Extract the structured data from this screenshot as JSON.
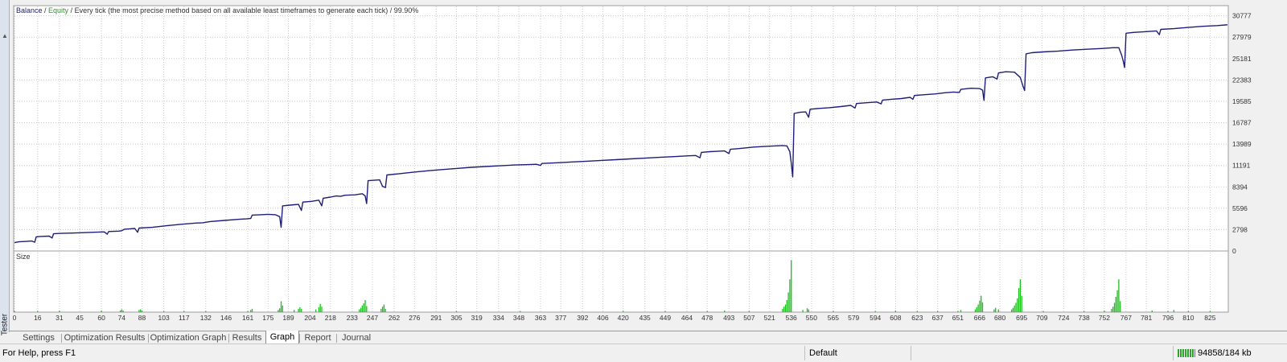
{
  "chart_header": {
    "balance": "Balance",
    "sep1": " / ",
    "equity": "Equity",
    "rest": " / Every tick (the most precise method based on all available least timeframes to generate each tick) / 99.90%"
  },
  "lower_pane_label": "Size",
  "side_caption": "Tester",
  "tabs": [
    "Settings",
    "Optimization Results",
    "Optimization Graph",
    "Results",
    "Graph",
    "Report",
    "Journal"
  ],
  "active_tab": "Graph",
  "status": {
    "help": "For Help, press F1",
    "profile": "Default",
    "memory": "94858/184 kb"
  },
  "colors": {
    "balance": "#1e1e78",
    "equity": "#2a9a2a",
    "size_bars": "#1bbf1b",
    "grid": "#c8c8c8",
    "background": "#ffffff"
  },
  "chart_data": {
    "type": "line",
    "series": [
      {
        "name": "Balance"
      },
      {
        "name": "Equity"
      }
    ],
    "x_ticks": [
      0,
      16,
      31,
      45,
      60,
      74,
      88,
      103,
      117,
      132,
      146,
      161,
      175,
      189,
      204,
      218,
      233,
      247,
      262,
      276,
      291,
      305,
      319,
      334,
      348,
      363,
      377,
      392,
      406,
      420,
      435,
      449,
      464,
      478,
      493,
      507,
      521,
      536,
      550,
      565,
      579,
      594,
      608,
      623,
      637,
      651,
      666,
      680,
      695,
      709,
      724,
      738,
      752,
      767,
      781,
      796,
      810,
      825
    ],
    "y_ticks": [
      0,
      2798,
      5596,
      8394,
      11191,
      13989,
      16787,
      19585,
      22383,
      25181,
      27979,
      30777
    ],
    "xlim": [
      0,
      837
    ],
    "ylim": [
      0,
      32000
    ],
    "balance_points": [
      [
        0,
        1100
      ],
      [
        3,
        1200
      ],
      [
        8,
        1250
      ],
      [
        12,
        1300
      ],
      [
        14,
        1150
      ],
      [
        15,
        1850
      ],
      [
        18,
        1900
      ],
      [
        24,
        1950
      ],
      [
        26,
        1700
      ],
      [
        27,
        2250
      ],
      [
        32,
        2300
      ],
      [
        40,
        2350
      ],
      [
        48,
        2400
      ],
      [
        55,
        2450
      ],
      [
        62,
        2500
      ],
      [
        64,
        2200
      ],
      [
        65,
        2550
      ],
      [
        72,
        2600
      ],
      [
        74,
        2650
      ],
      [
        76,
        2850
      ],
      [
        80,
        2900
      ],
      [
        83,
        2950
      ],
      [
        85,
        2450
      ],
      [
        86,
        3000
      ],
      [
        95,
        3100
      ],
      [
        105,
        3300
      ],
      [
        115,
        3500
      ],
      [
        125,
        3650
      ],
      [
        130,
        3700
      ],
      [
        135,
        3850
      ],
      [
        145,
        4000
      ],
      [
        155,
        4150
      ],
      [
        160,
        4200
      ],
      [
        163,
        4250
      ],
      [
        164,
        4700
      ],
      [
        170,
        4750
      ],
      [
        175,
        4800
      ],
      [
        180,
        4750
      ],
      [
        183,
        4500
      ],
      [
        184,
        3100
      ],
      [
        185,
        5900
      ],
      [
        190,
        6000
      ],
      [
        193,
        6050
      ],
      [
        196,
        6100
      ],
      [
        198,
        5300
      ],
      [
        199,
        6400
      ],
      [
        205,
        6500
      ],
      [
        210,
        6650
      ],
      [
        212,
        5900
      ],
      [
        213,
        6900
      ],
      [
        218,
        7050
      ],
      [
        222,
        7200
      ],
      [
        225,
        7150
      ],
      [
        228,
        7300
      ],
      [
        235,
        7350
      ],
      [
        240,
        7500
      ],
      [
        242,
        7200
      ],
      [
        243,
        6200
      ],
      [
        244,
        9200
      ],
      [
        248,
        9250
      ],
      [
        252,
        9300
      ],
      [
        254,
        8450
      ],
      [
        256,
        8300
      ],
      [
        257,
        9950
      ],
      [
        265,
        10100
      ],
      [
        275,
        10300
      ],
      [
        285,
        10500
      ],
      [
        295,
        10650
      ],
      [
        305,
        10800
      ],
      [
        315,
        10950
      ],
      [
        325,
        11050
      ],
      [
        335,
        11150
      ],
      [
        345,
        11250
      ],
      [
        355,
        11300
      ],
      [
        360,
        11350
      ],
      [
        363,
        11200
      ],
      [
        364,
        11450
      ],
      [
        375,
        11550
      ],
      [
        385,
        11650
      ],
      [
        395,
        11750
      ],
      [
        405,
        11850
      ],
      [
        415,
        11950
      ],
      [
        425,
        12050
      ],
      [
        435,
        12150
      ],
      [
        445,
        12250
      ],
      [
        455,
        12350
      ],
      [
        465,
        12450
      ],
      [
        470,
        12500
      ],
      [
        473,
        12200
      ],
      [
        474,
        12900
      ],
      [
        480,
        13000
      ],
      [
        490,
        13100
      ],
      [
        493,
        12750
      ],
      [
        494,
        13300
      ],
      [
        500,
        13400
      ],
      [
        510,
        13600
      ],
      [
        520,
        13700
      ],
      [
        530,
        13800
      ],
      [
        533,
        13750
      ],
      [
        535,
        13000
      ],
      [
        536,
        11500
      ],
      [
        537,
        9700
      ],
      [
        538,
        18000
      ],
      [
        542,
        18150
      ],
      [
        546,
        18200
      ],
      [
        548,
        17500
      ],
      [
        549,
        18550
      ],
      [
        555,
        18650
      ],
      [
        562,
        18750
      ],
      [
        570,
        18900
      ],
      [
        577,
        19050
      ],
      [
        580,
        18700
      ],
      [
        581,
        19300
      ],
      [
        588,
        19400
      ],
      [
        595,
        19500
      ],
      [
        598,
        19250
      ],
      [
        599,
        19750
      ],
      [
        605,
        19850
      ],
      [
        612,
        19950
      ],
      [
        618,
        20100
      ],
      [
        620,
        19850
      ],
      [
        621,
        20350
      ],
      [
        628,
        20450
      ],
      [
        635,
        20550
      ],
      [
        642,
        20700
      ],
      [
        648,
        20800
      ],
      [
        652,
        20750
      ],
      [
        653,
        21150
      ],
      [
        660,
        21300
      ],
      [
        666,
        21250
      ],
      [
        668,
        21050
      ],
      [
        669,
        19700
      ],
      [
        670,
        22650
      ],
      [
        675,
        22800
      ],
      [
        678,
        22500
      ],
      [
        679,
        23300
      ],
      [
        684,
        23450
      ],
      [
        690,
        23400
      ],
      [
        694,
        22700
      ],
      [
        696,
        21500
      ],
      [
        697,
        21000
      ],
      [
        698,
        25800
      ],
      [
        702,
        25950
      ],
      [
        710,
        26050
      ],
      [
        720,
        26150
      ],
      [
        730,
        26300
      ],
      [
        740,
        26400
      ],
      [
        750,
        26500
      ],
      [
        758,
        26600
      ],
      [
        762,
        26600
      ],
      [
        764,
        25600
      ],
      [
        765,
        24900
      ],
      [
        766,
        24000
      ],
      [
        767,
        28500
      ],
      [
        772,
        28600
      ],
      [
        780,
        28700
      ],
      [
        788,
        28800
      ],
      [
        790,
        28300
      ],
      [
        791,
        29000
      ],
      [
        800,
        29100
      ],
      [
        810,
        29250
      ],
      [
        820,
        29400
      ],
      [
        830,
        29500
      ],
      [
        837,
        29600
      ]
    ],
    "size_bars": [
      [
        0,
        0.02
      ],
      [
        16,
        0.02
      ],
      [
        31,
        0.03
      ],
      [
        60,
        0.03
      ],
      [
        73,
        0.03
      ],
      [
        74,
        0.05
      ],
      [
        75,
        0.03
      ],
      [
        86,
        0.04
      ],
      [
        87,
        0.05
      ],
      [
        88,
        0.03
      ],
      [
        103,
        0.02
      ],
      [
        117,
        0.02
      ],
      [
        132,
        0.02
      ],
      [
        161,
        0.02
      ],
      [
        163,
        0.04
      ],
      [
        164,
        0.06
      ],
      [
        182,
        0.04
      ],
      [
        183,
        0.07
      ],
      [
        184,
        0.2
      ],
      [
        185,
        0.12
      ],
      [
        193,
        0.04
      ],
      [
        196,
        0.06
      ],
      [
        197,
        0.09
      ],
      [
        198,
        0.06
      ],
      [
        208,
        0.05
      ],
      [
        210,
        0.09
      ],
      [
        211,
        0.15
      ],
      [
        212,
        0.1
      ],
      [
        238,
        0.05
      ],
      [
        239,
        0.08
      ],
      [
        240,
        0.12
      ],
      [
        241,
        0.16
      ],
      [
        242,
        0.22
      ],
      [
        243,
        0.11
      ],
      [
        253,
        0.06
      ],
      [
        254,
        0.1
      ],
      [
        255,
        0.14
      ],
      [
        256,
        0.06
      ],
      [
        305,
        0.02
      ],
      [
        349,
        0.02
      ],
      [
        420,
        0.02
      ],
      [
        449,
        0.02
      ],
      [
        478,
        0.02
      ],
      [
        490,
        0.03
      ],
      [
        507,
        0.02
      ],
      [
        530,
        0.06
      ],
      [
        531,
        0.1
      ],
      [
        532,
        0.14
      ],
      [
        533,
        0.22
      ],
      [
        534,
        0.36
      ],
      [
        535,
        0.6
      ],
      [
        536,
        0.95
      ],
      [
        544,
        0.04
      ],
      [
        547,
        0.07
      ],
      [
        548,
        0.05
      ],
      [
        565,
        0.02
      ],
      [
        594,
        0.02
      ],
      [
        608,
        0.03
      ],
      [
        623,
        0.02
      ],
      [
        637,
        0.02
      ],
      [
        651,
        0.02
      ],
      [
        653,
        0.04
      ],
      [
        663,
        0.05
      ],
      [
        664,
        0.09
      ],
      [
        665,
        0.14
      ],
      [
        666,
        0.21
      ],
      [
        667,
        0.3
      ],
      [
        668,
        0.18
      ],
      [
        676,
        0.05
      ],
      [
        677,
        0.08
      ],
      [
        679,
        0.05
      ],
      [
        688,
        0.05
      ],
      [
        689,
        0.08
      ],
      [
        690,
        0.12
      ],
      [
        691,
        0.17
      ],
      [
        692,
        0.25
      ],
      [
        693,
        0.44
      ],
      [
        694,
        0.6
      ],
      [
        695,
        0.3
      ],
      [
        710,
        0.02
      ],
      [
        738,
        0.02
      ],
      [
        752,
        0.03
      ],
      [
        757,
        0.06
      ],
      [
        758,
        0.1
      ],
      [
        759,
        0.17
      ],
      [
        760,
        0.28
      ],
      [
        761,
        0.4
      ],
      [
        762,
        0.6
      ],
      [
        763,
        0.2
      ],
      [
        785,
        0.03
      ],
      [
        796,
        0.02
      ],
      [
        800,
        0.04
      ],
      [
        810,
        0.02
      ],
      [
        825,
        0.02
      ]
    ]
  }
}
